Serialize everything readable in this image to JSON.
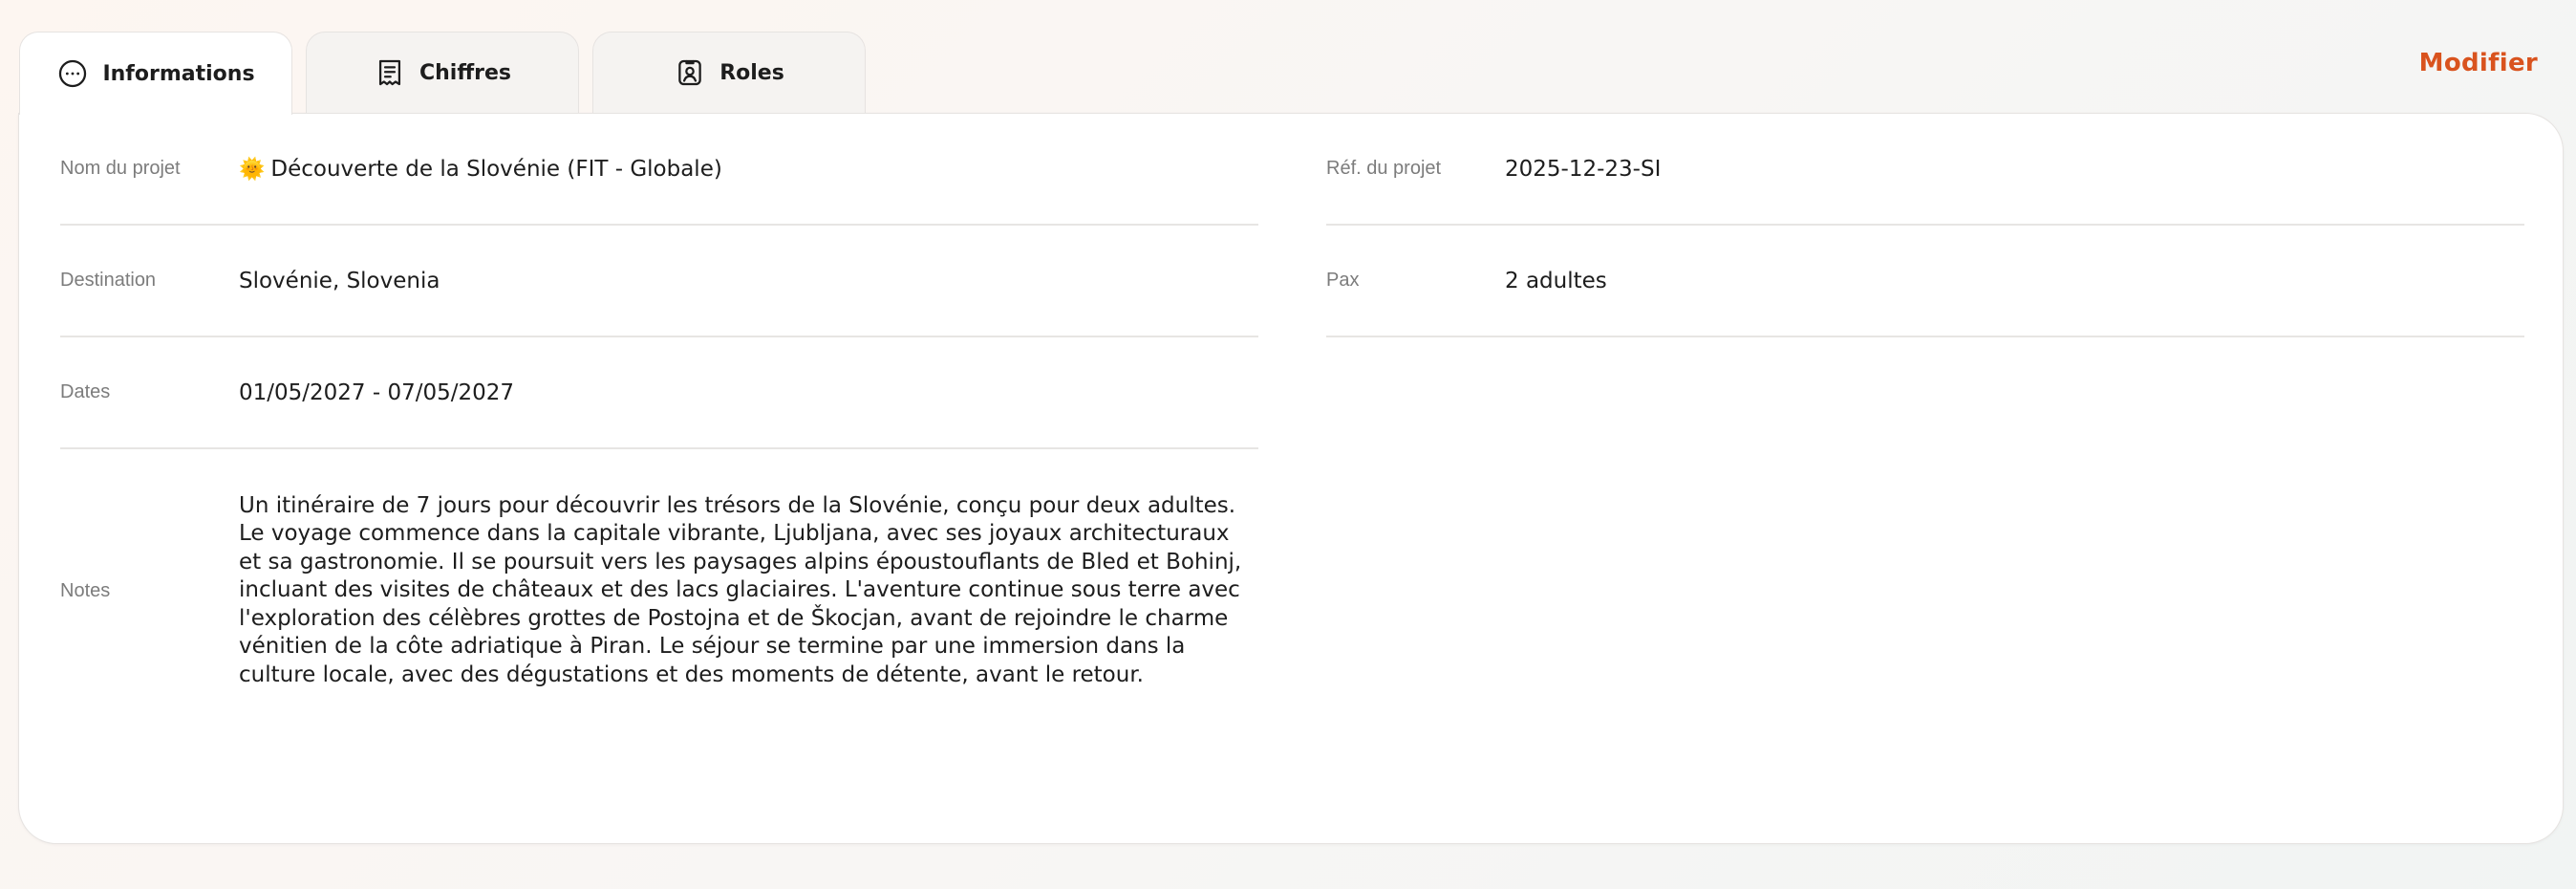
{
  "tabs": [
    {
      "label": "Informations",
      "icon": "chat-bubble-icon",
      "active": true
    },
    {
      "label": "Chiffres",
      "icon": "receipt-icon",
      "active": false
    },
    {
      "label": "Roles",
      "icon": "user-badge-icon",
      "active": false
    }
  ],
  "actions": {
    "modify_label": "Modifier"
  },
  "fields": {
    "project_name": {
      "label": "Nom du projet",
      "emoji": "🌞",
      "value": "Découverte de la Slovénie (FIT - Globale)"
    },
    "project_ref": {
      "label": "Réf. du projet",
      "value": "2025-12-23-SI"
    },
    "destination": {
      "label": "Destination",
      "value": "Slovénie, Slovenia"
    },
    "pax": {
      "label": "Pax",
      "value": "2 adultes"
    },
    "dates": {
      "label": "Dates",
      "value": "01/05/2027 - 07/05/2027"
    },
    "notes": {
      "label": "Notes",
      "value": "Un itinéraire de 7 jours pour découvrir les trésors de la Slovénie, conçu pour deux adultes. Le voyage commence dans la capitale vibrante, Ljubljana, avec ses joyaux architecturaux et sa gastronomie. Il se poursuit vers les paysages alpins époustouflants de Bled et Bohinj, incluant des visites de châteaux et des lacs glaciaires. L'aventure continue sous terre avec l'exploration des célèbres grottes de Postojna et de Škocjan, avant de rejoindre le charme vénitien de la côte adriatique à Piran. Le séjour se termine par une immersion dans la culture locale, avec des dégustations et des moments de détente, avant le retour."
    }
  },
  "colors": {
    "accent": "#d9531e",
    "label": "#7c7c7c",
    "divider": "#e7e5e3"
  }
}
